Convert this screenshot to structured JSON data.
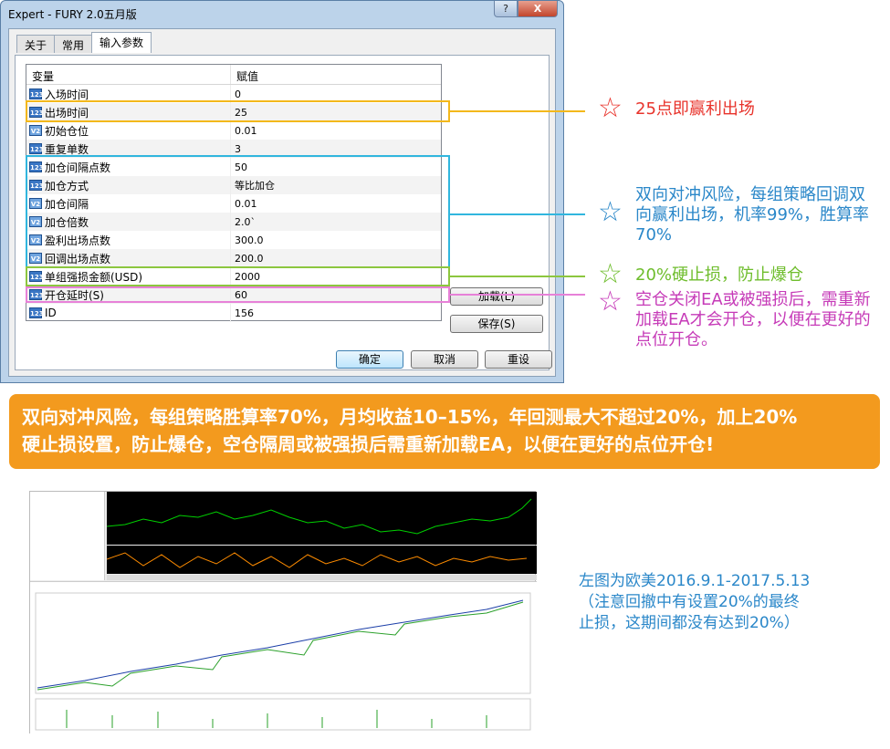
{
  "window": {
    "title": "Expert - FURY 2.0五月版",
    "help_label": "?",
    "close_label": "X"
  },
  "tabs": [
    {
      "label": "关于"
    },
    {
      "label": "常用"
    },
    {
      "label": "输入参数"
    }
  ],
  "grid": {
    "col_variable": "变量",
    "col_value": "赋值",
    "rows": [
      {
        "icon": "123",
        "name": "入场时间",
        "value": "0"
      },
      {
        "icon": "123",
        "name": "出场时间",
        "value": "25"
      },
      {
        "icon": "V2",
        "name": "初始仓位",
        "value": "0.01"
      },
      {
        "icon": "123",
        "name": "重复单数",
        "value": "3"
      },
      {
        "icon": "123",
        "name": "加仓间隔点数",
        "value": "50"
      },
      {
        "icon": "123",
        "name": "加仓方式",
        "value": "等比加仓"
      },
      {
        "icon": "V2",
        "name": "加仓间隔",
        "value": "0.01"
      },
      {
        "icon": "V2",
        "name": "加仓倍数",
        "value": "2.0`"
      },
      {
        "icon": "V2",
        "name": "盈利出场点数",
        "value": "300.0"
      },
      {
        "icon": "V2",
        "name": "回调出场点数",
        "value": "200.0"
      },
      {
        "icon": "123",
        "name": "单组强损金额(USD)",
        "value": "2000"
      },
      {
        "icon": "123",
        "name": "开仓延时(S)",
        "value": "60"
      },
      {
        "icon": "123",
        "name": "ID",
        "value": "156"
      }
    ]
  },
  "buttons": {
    "load": "加载(L)",
    "save": "保存(S)",
    "ok": "确定",
    "cancel": "取消",
    "reset": "重设"
  },
  "annotations": [
    {
      "text": "25点即赢利出场",
      "color": "#e8332b"
    },
    {
      "text": "双向对冲风险，每组策略回调双向赢利出场，机率99%，胜算率70%",
      "color": "#2a87c9"
    },
    {
      "text": "20%硬止损，防止爆仓",
      "color": "#6ebd2c"
    },
    {
      "text": "空仓关闭EA或被强损后，需重新加载EA才会开仓，以便在更好的点位开仓。",
      "color": "#c63bb8"
    }
  ],
  "banner": {
    "line1": "双向对冲风险，每组策略胜算率70%，月均收益10–15%，年回测最大不超过20%，加上20%",
    "line2": "硬止损设置，防止爆仓，空仓隔周或被强损后需重新加载EA，以便在更好的点位开仓!"
  },
  "caption": {
    "line1": "左图为欧美2016.9.1-2017.5.13",
    "line2": "（注意回撤中有设置20%的最终",
    "line3": "止损，这期间都没有达到20%）"
  },
  "colors": {
    "yellow_box": "#f3b81b",
    "blue_box": "#31b6de",
    "green_box": "#8cc63f",
    "pink_box": "#e781d8",
    "banner": "#f39a1e"
  }
}
